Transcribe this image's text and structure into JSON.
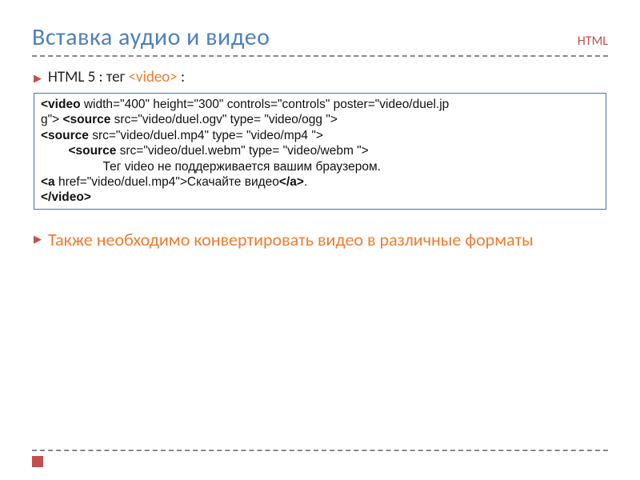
{
  "header": {
    "title": "Вставка аудио и видео",
    "tag": "HTML"
  },
  "bullet1": {
    "prefix": "HTML 5 : тег  ",
    "tag": "<video>",
    "suffix": " :"
  },
  "code": {
    "l1a": "<video",
    "l1b": " width=\"400\" height=\"300\" controls=\"controls\" poster=\"video/duel.jp",
    "l2a": "g\">  ",
    "l2b": "<source",
    "l2c": " src=\"video/duel.ogv\" type= \"video/ogg \">",
    "l3a": "<source",
    "l3b": " src=\"video/duel.mp4\" type= \"video/mp4 \">",
    "l4a": "        <source",
    "l4b_pre": "        ",
    "l4b": "<source",
    "l4c": " src=\"video/duel.webm\" type= \"video/webm \">",
    "l5": "                  Тег video не поддерживается вашим браузером.",
    "l6a": "<a",
    "l6b": " href=\"video/duel.mp4\">Скачайте видео",
    "l6c": "</a>",
    "l6d": ".",
    "l7": "</video>"
  },
  "bullet2": {
    "text": "Также необходимо конвертировать видео в различные форматы"
  }
}
